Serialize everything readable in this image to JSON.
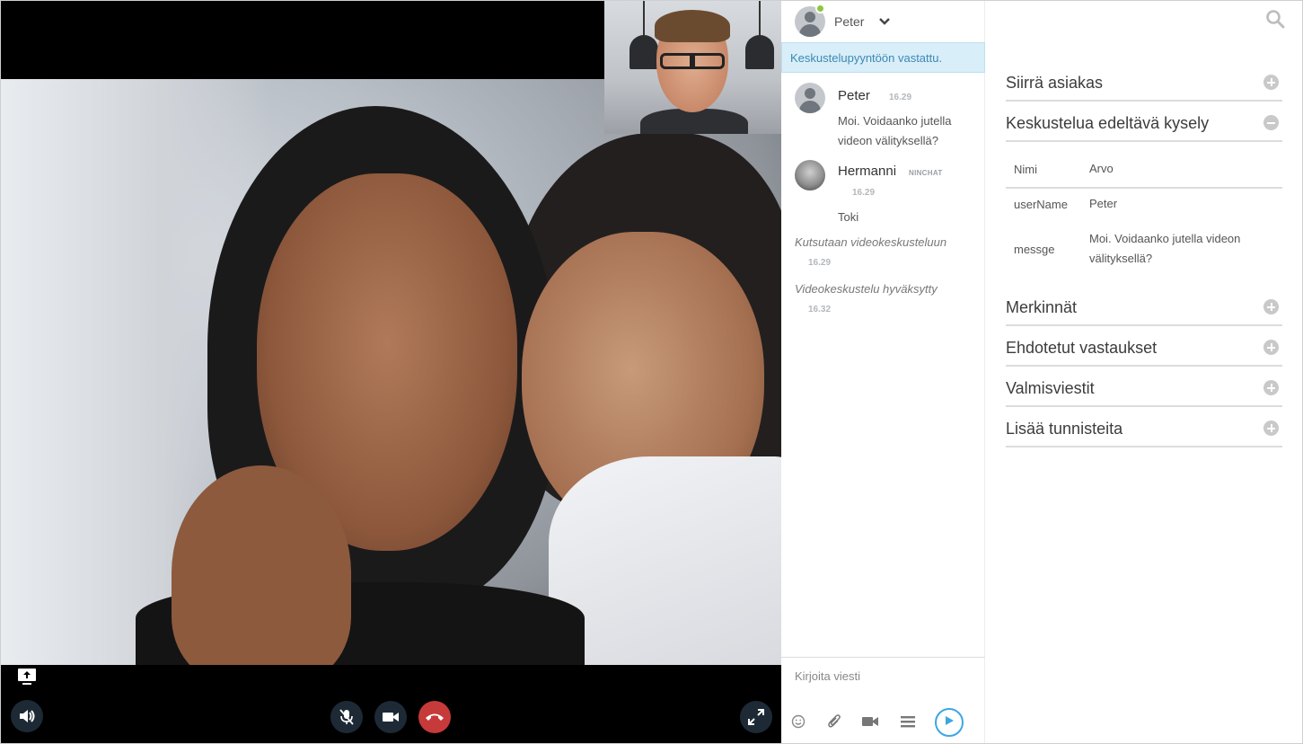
{
  "video": {
    "controls": {
      "screen_share": "screen-share-icon",
      "volume": "volume-icon",
      "mute": "mic-off-icon",
      "camera": "video-camera-icon",
      "hangup": "hangup-icon",
      "fullscreen": "fullscreen-icon"
    },
    "colors": {
      "hangup": "#c73a3a",
      "control_bg": "#1d2a36"
    }
  },
  "chat": {
    "header": {
      "name": "Peter",
      "online": true
    },
    "notice": "Keskustelupyyntöön vastattu.",
    "messages": [
      {
        "name": "Peter",
        "time": "16.29",
        "text": "Moi. Voidaanko jutella videon välityksellä?"
      },
      {
        "name": "Hermanni",
        "badge": "NINCHAT",
        "time": "16.29",
        "text": "Toki"
      }
    ],
    "system": [
      {
        "text": "Kutsutaan videokeskusteluun",
        "time": "16.29"
      },
      {
        "text": "Videokeskustelu hyväksytty",
        "time": "16.32"
      }
    ],
    "composer": {
      "placeholder": "Kirjoita viesti"
    }
  },
  "panel": {
    "sections": [
      {
        "title": "Siirrä asiakas",
        "expanded": false
      },
      {
        "title": "Keskustelua edeltävä kysely",
        "expanded": true
      },
      {
        "title": "Merkinnät",
        "expanded": false
      },
      {
        "title": "Ehdotetut vastaukset",
        "expanded": false
      },
      {
        "title": "Valmisviestit",
        "expanded": false
      },
      {
        "title": "Lisää tunnisteita",
        "expanded": false
      }
    ],
    "survey": [
      {
        "key": "Nimi",
        "value": "Arvo"
      },
      {
        "key": "userName",
        "value": "Peter"
      },
      {
        "key": "messge",
        "value": "Moi. Voidaanko jutella videon välityksellä?"
      }
    ]
  },
  "colors": {
    "accent": "#3ba7e3",
    "notice_bg": "#d8eef8",
    "notice_text": "#3d88b4",
    "online": "#8cc63f"
  }
}
